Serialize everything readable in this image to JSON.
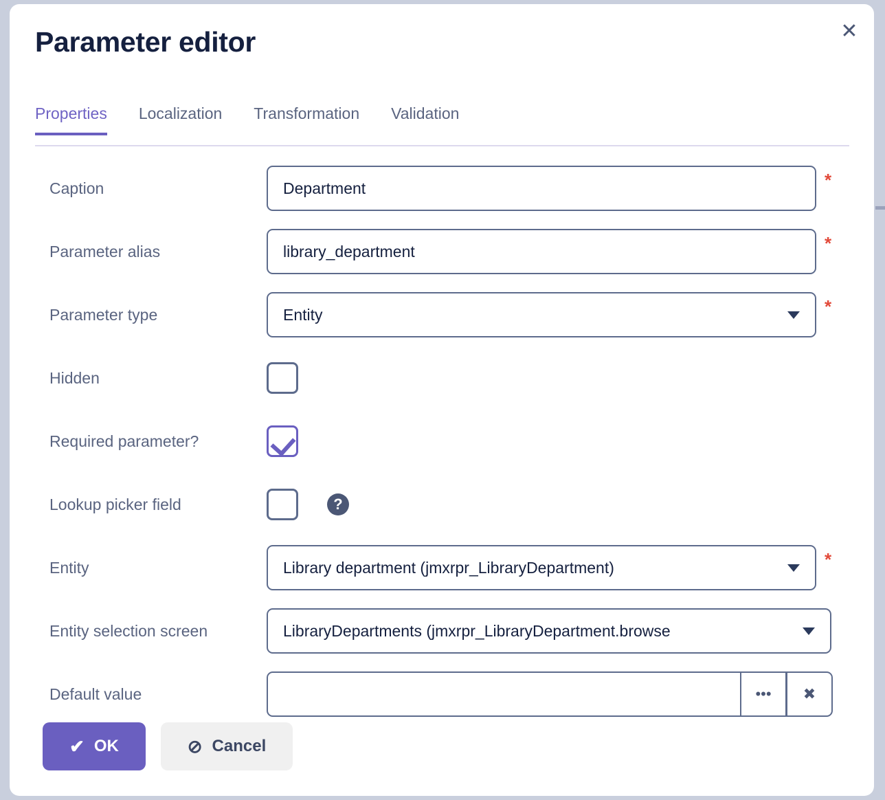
{
  "dialog": {
    "title": "Parameter editor",
    "close_icon": "close-icon"
  },
  "tabs": [
    {
      "label": "Properties",
      "active": true
    },
    {
      "label": "Localization",
      "active": false
    },
    {
      "label": "Transformation",
      "active": false
    },
    {
      "label": "Validation",
      "active": false
    }
  ],
  "fields": {
    "caption": {
      "label": "Caption",
      "value": "Department",
      "placeholder": "",
      "required_marker": "*"
    },
    "parameter_alias": {
      "label": "Parameter alias",
      "value": "library_department",
      "placeholder": "",
      "required_marker": "*"
    },
    "parameter_type": {
      "label": "Parameter type",
      "value": "Entity",
      "required_marker": "*",
      "caret_icon": "chevron-down-icon"
    },
    "hidden": {
      "label": "Hidden",
      "checked": false
    },
    "required_parameter": {
      "label": "Required parameter?",
      "checked": true
    },
    "lookup_picker_field": {
      "label": "Lookup picker field",
      "checked": false,
      "help_icon": "help-icon",
      "help_glyph": "?"
    },
    "entity": {
      "label": "Entity",
      "value": "Library department (jmxrpr_LibraryDepartment)",
      "required_marker": "*",
      "caret_icon": "chevron-down-icon"
    },
    "entity_selection_screen": {
      "label": "Entity selection screen",
      "value": "LibraryDepartments (jmxrpr_LibraryDepartment.browse",
      "caret_icon": "chevron-down-icon"
    },
    "default_value": {
      "label": "Default value",
      "value": "",
      "placeholder": "",
      "lookup_button_glyph": "•••",
      "lookup_button_icon": "ellipsis-icon",
      "clear_button_glyph": "✖",
      "clear_button_icon": "clear-icon"
    }
  },
  "footer": {
    "ok_label": "OK",
    "ok_glyph": "✔",
    "cancel_label": "Cancel",
    "cancel_glyph": "⊘"
  },
  "colors": {
    "accent": "#6a5fc0",
    "required": "#e24a3a",
    "label_text": "#5a6480",
    "value_text": "#15203f",
    "border": "#5d6b8c",
    "page_background": "#c9cfdd"
  }
}
